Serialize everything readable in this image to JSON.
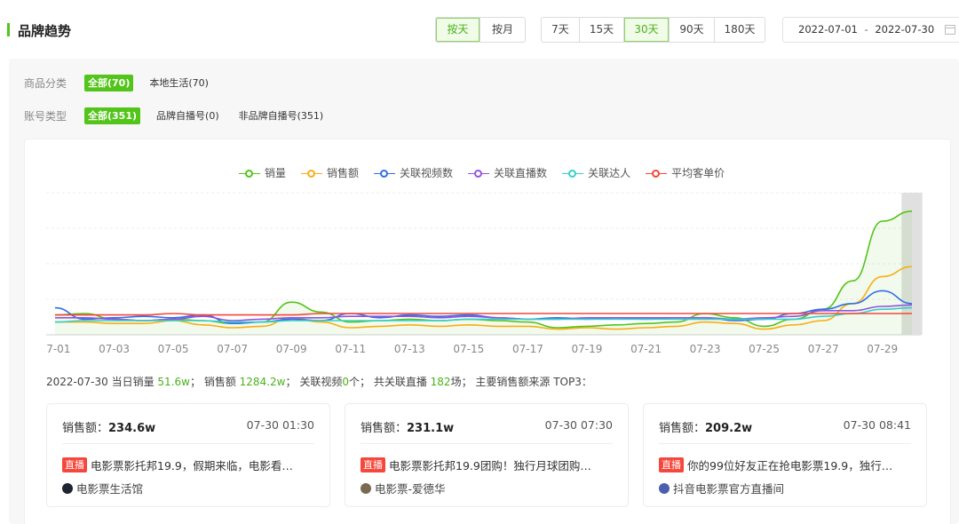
{
  "header": {
    "title": "品牌趋势",
    "granularity": [
      "按天",
      "按月"
    ],
    "active_granularity": "按天",
    "ranges": [
      "7天",
      "15天",
      "30天",
      "90天",
      "180天"
    ],
    "active_range": "30天",
    "date_start": "2022-07-01",
    "date_sep": "-",
    "date_end": "2022-07-30",
    "accent_color": "#52c41a"
  },
  "filters": {
    "category": {
      "label": "商品分类",
      "options": [
        "全部(70)",
        "本地生活(70)"
      ],
      "active": "全部(70)"
    },
    "account": {
      "label": "账号类型",
      "options": [
        "全部(351)",
        "品牌自播号(0)",
        "非品牌自播号(351)"
      ],
      "active": "全部(351)"
    }
  },
  "chart_data": {
    "type": "line",
    "x": [
      "07-01",
      "07-02",
      "07-03",
      "07-04",
      "07-05",
      "07-06",
      "07-07",
      "07-08",
      "07-09",
      "07-10",
      "07-11",
      "07-12",
      "07-13",
      "07-14",
      "07-15",
      "07-16",
      "07-17",
      "07-18",
      "07-19",
      "07-20",
      "07-21",
      "07-22",
      "07-23",
      "07-24",
      "07-25",
      "07-26",
      "07-27",
      "07-28",
      "07-29",
      "07-30"
    ],
    "tick_labels": [
      "07-01",
      "07-03",
      "07-05",
      "07-07",
      "07-09",
      "07-11",
      "07-13",
      "07-15",
      "07-17",
      "07-19",
      "07-21",
      "07-23",
      "07-25",
      "07-27",
      "07-29"
    ],
    "ylim": [
      0,
      100
    ],
    "grid": true,
    "legend_position": "top-center",
    "highlight_last": true,
    "series": [
      {
        "name": "销量",
        "color": "#52c41a",
        "area": true,
        "values": [
          14,
          15,
          11,
          10,
          11,
          10,
          8,
          9,
          23,
          16,
          9,
          10,
          11,
          10,
          11,
          10,
          9,
          5,
          6,
          7,
          8,
          9,
          15,
          12,
          6,
          11,
          18,
          38,
          80,
          87
        ]
      },
      {
        "name": "销售额",
        "color": "#faad14",
        "values": [
          9,
          9,
          8,
          8,
          10,
          7,
          5,
          6,
          12,
          9,
          5,
          6,
          7,
          6,
          7,
          6,
          6,
          4,
          5,
          4,
          5,
          6,
          9,
          8,
          4,
          7,
          10,
          22,
          41,
          48
        ]
      },
      {
        "name": "关联视频数",
        "color": "#2f6fe8",
        "values": [
          19,
          11,
          12,
          13,
          12,
          14,
          8,
          9,
          11,
          10,
          15,
          12,
          14,
          13,
          14,
          12,
          11,
          12,
          11,
          12,
          11,
          12,
          12,
          10,
          11,
          15,
          18,
          22,
          31,
          22
        ]
      },
      {
        "name": "关联直播数",
        "color": "#9254de",
        "values": [
          12,
          12,
          11,
          10,
          11,
          13,
          10,
          11,
          12,
          12,
          13,
          13,
          13,
          12,
          13,
          12,
          11,
          11,
          12,
          12,
          12,
          12,
          12,
          11,
          12,
          13,
          17,
          17,
          20,
          21
        ]
      },
      {
        "name": "关联达人",
        "color": "#36cfc9",
        "values": [
          9,
          10,
          10,
          10,
          10,
          10,
          9,
          9,
          10,
          10,
          10,
          10,
          10,
          10,
          11,
          11,
          11,
          11,
          11,
          11,
          11,
          11,
          11,
          11,
          11,
          11,
          13,
          15,
          18,
          19
        ]
      },
      {
        "name": "平均客单价",
        "color": "#f5473b",
        "values": [
          14,
          14,
          14,
          14,
          15,
          14,
          14,
          14,
          14,
          15,
          15,
          15,
          15,
          15,
          15,
          15,
          15,
          15,
          15,
          15,
          15,
          15,
          15,
          15,
          15,
          15,
          15,
          15,
          15,
          15
        ]
      }
    ]
  },
  "summary": {
    "date": "2022-07-30",
    "sales_label": "当日销量",
    "sales_value": "51.6w",
    "sep1": "；",
    "amount_label": "销售额",
    "amount_value": "1284.2w",
    "sep2": "；",
    "video_label": "关联视频",
    "video_value": "0",
    "video_unit": "个；",
    "live_label": "共关联直播",
    "live_value": "182",
    "live_unit": "场；",
    "top_label": "主要销售额来源 TOP3："
  },
  "top3": [
    {
      "amount_label": "销售额：",
      "amount": "234.6w",
      "time": "07-30 01:30",
      "tag": "直播",
      "title": "电影票影托邦19.9，假期来临，电影看…",
      "source": "电影票生活馆",
      "avatar_color": "#1e2430"
    },
    {
      "amount_label": "销售额：",
      "amount": "231.1w",
      "time": "07-30 07:30",
      "tag": "直播",
      "title": "电影票影托邦19.9团购！独行月球团购…",
      "source": "电影票-爱德华",
      "avatar_color": "#7a6a52"
    },
    {
      "amount_label": "销售额：",
      "amount": "209.2w",
      "time": "07-30 08:41",
      "tag": "直播",
      "title": "你的99位好友正在抢电影票19.9，独行…",
      "source": "抖音电影票官方直播间",
      "avatar_color": "#4a5fb0"
    }
  ]
}
